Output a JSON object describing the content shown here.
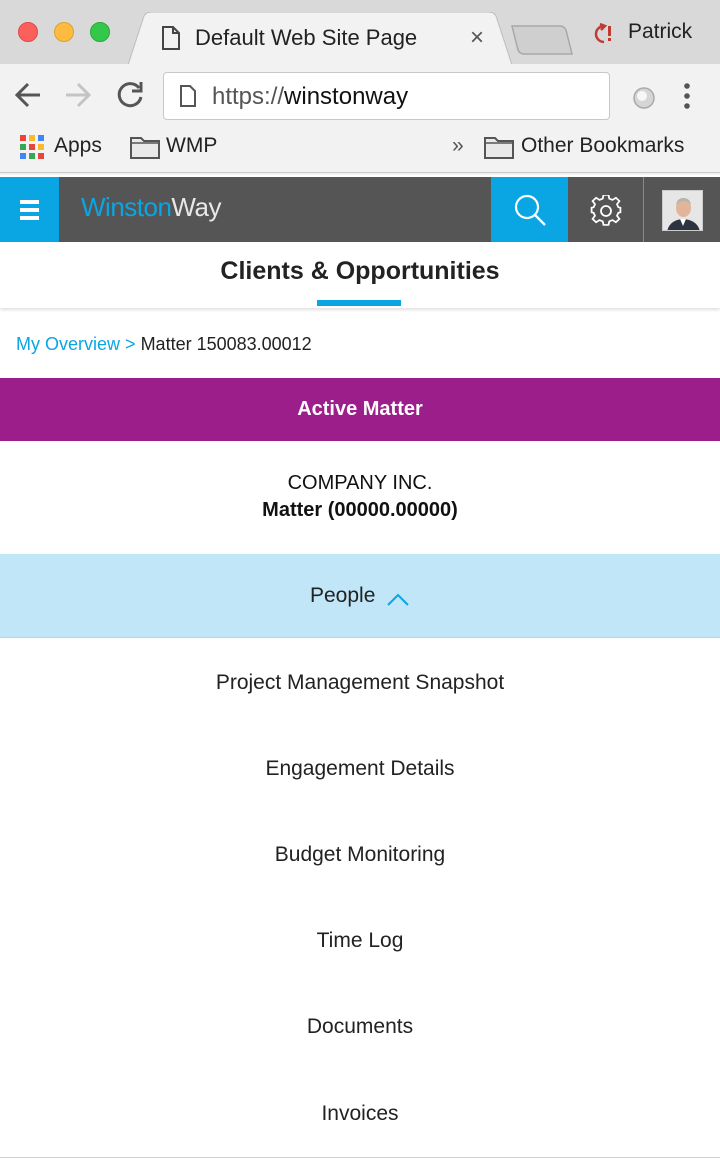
{
  "browser": {
    "tab_title": "Default Web Site Page",
    "tab_close": "×",
    "profile_name": "Patrick",
    "url_prefix": "https://",
    "url_host": "winstonway",
    "bookmarks": {
      "apps": "Apps",
      "wmp": "WMP",
      "overflow": "»",
      "other": "Other Bookmarks"
    }
  },
  "app": {
    "logo_part1": "Winston",
    "logo_part2": "Way",
    "accent_color": "#0aa6e3",
    "header_color": "#555555"
  },
  "page": {
    "title": "Clients & Opportunities",
    "breadcrumb": {
      "link": "My Overview",
      "separator": ">",
      "current": "Matter 150083.00012"
    },
    "status_banner": "Active Matter",
    "status_color": "#9c1e8a",
    "company_name": "COMPANY INC.",
    "matter_name": "Matter (00000.00000)",
    "expanded_section": "People",
    "sections": [
      "Project Management Snapshot",
      "Engagement Details",
      "Budget Monitoring",
      "Time Log",
      "Documents",
      "Invoices"
    ]
  }
}
